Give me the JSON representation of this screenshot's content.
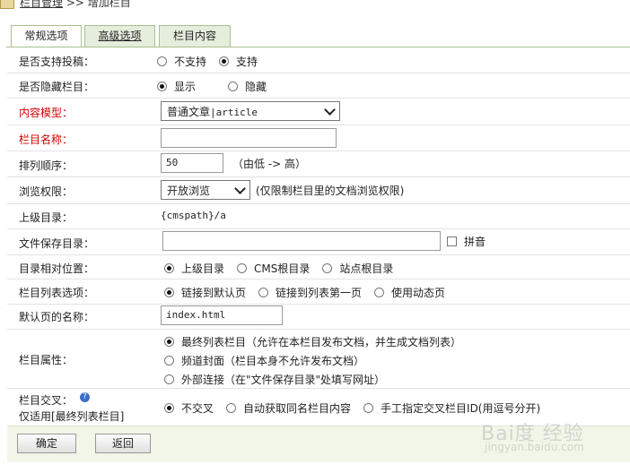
{
  "breadcrumb": {
    "section": "栏目管理",
    "sep": ">>",
    "page": "增加栏目"
  },
  "tabs": [
    {
      "label": "常规选项",
      "active": true
    },
    {
      "label": "高级选项",
      "active": false
    },
    {
      "label": "栏目内容",
      "active": false
    }
  ],
  "form": {
    "allow_submit": {
      "label": "是否支持投稿：",
      "options": [
        "不支持",
        "支持"
      ],
      "selected": "支持"
    },
    "hidden": {
      "label": "是否隐藏栏目：",
      "options": [
        "显示",
        "隐藏"
      ],
      "selected": "显示"
    },
    "content_model": {
      "label": "内容模型：",
      "value": "普通文章",
      "value_suffix": "|article"
    },
    "column_name": {
      "label": "栏目名称：",
      "value": ""
    },
    "sort_order": {
      "label": "排列顺序：",
      "value": "50",
      "hint": "（由低 -> 高）"
    },
    "browse_perm": {
      "label": "浏览权限：",
      "value": "开放浏览",
      "hint": "(仅限制栏目里的文档浏览权限)"
    },
    "parent_dir": {
      "label": "上级目录：",
      "value": "{cmspath}/a"
    },
    "save_dir": {
      "label": "文件保存目录：",
      "value": "",
      "pinyin_label": "拼音",
      "pinyin_checked": false
    },
    "relative_pos": {
      "label": "目录相对位置：",
      "options": [
        "上级目录",
        "CMS根目录",
        "站点根目录"
      ],
      "selected": "上级目录"
    },
    "list_option": {
      "label": "栏目列表选项：",
      "options": [
        "链接到默认页",
        "链接到列表第一页",
        "使用动态页"
      ],
      "selected": "链接到默认页"
    },
    "default_page": {
      "label": "默认页的名称：",
      "value": "index.html"
    },
    "column_attr": {
      "label": "栏目属性：",
      "options": [
        "最终列表栏目（允许在本栏目发布文档，并生成文档列表）",
        "频道封面（栏目本身不允许发布文档）",
        "外部连接（在\"文件保存目录\"处填写网址）"
      ],
      "selected": 0
    },
    "cross": {
      "label": "栏目交叉：",
      "sublabel": "仅适用[最终列表栏目]",
      "help_glyph": "?",
      "options": [
        "不交叉",
        "自动获取同名栏目内容",
        "手工指定交叉栏目ID(用逗号分开)"
      ],
      "selected": "不交叉"
    }
  },
  "buttons": {
    "ok": "确定",
    "back": "返回"
  },
  "watermark": {
    "brand": "Bai度 经验",
    "url": "jingyan.baidu.com"
  },
  "colors": {
    "required_label": "#d00000",
    "tab_bg": "#e5eedd",
    "tab_border": "#a9c08b",
    "footer_bg": "#f1f6e9",
    "help_icon": "#3a6fc7"
  }
}
